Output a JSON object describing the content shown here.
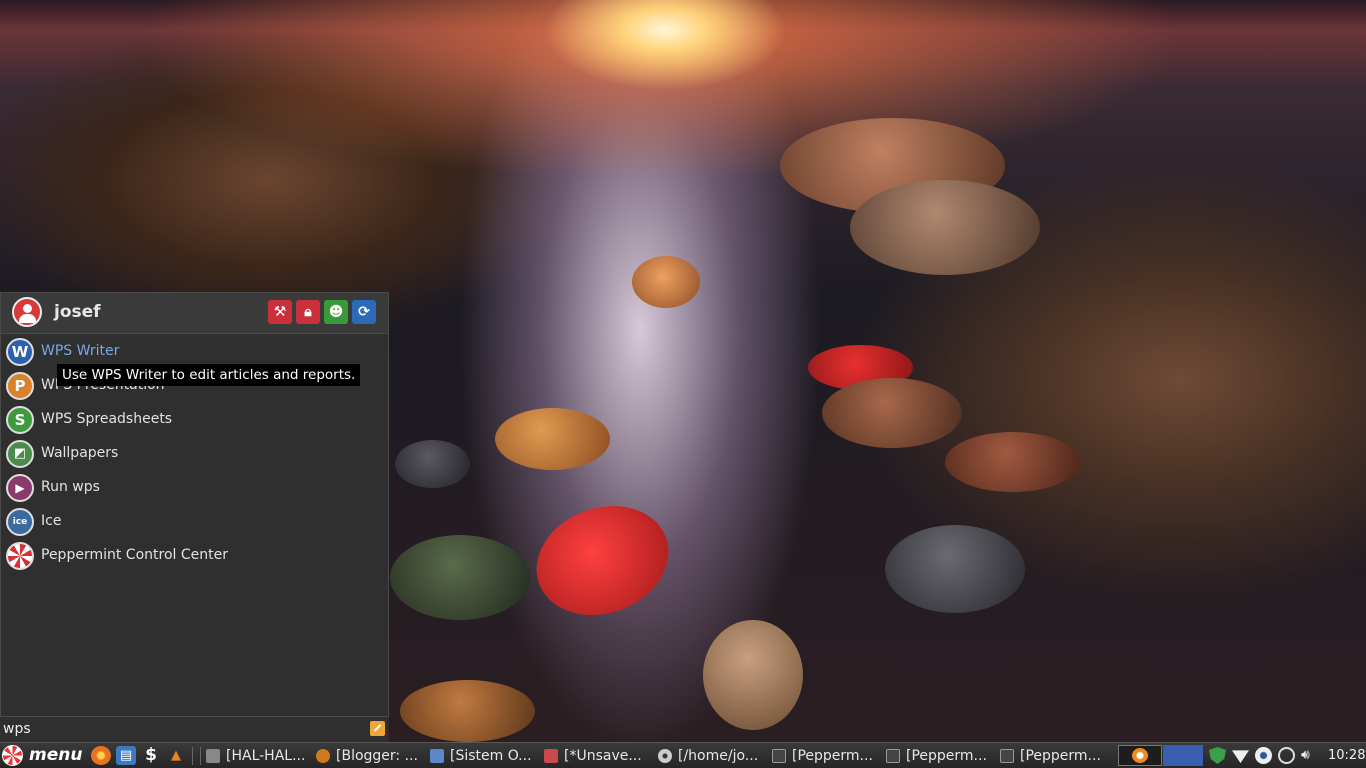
{
  "menu": {
    "username": "josef",
    "header_buttons": [
      {
        "name": "settings",
        "icon": "tools-icon",
        "color": "#c9303a"
      },
      {
        "name": "lock",
        "icon": "lock-icon",
        "color": "#c9303a"
      },
      {
        "name": "users",
        "icon": "users-icon",
        "color": "#3a9a3a"
      },
      {
        "name": "logout",
        "icon": "logout-icon",
        "color": "#2a6ab8"
      }
    ],
    "items": [
      {
        "label": "WPS Writer",
        "letter": "W",
        "color": "#2b5fb0"
      },
      {
        "label": "WPS Presentation",
        "letter": "P",
        "color": "#d9822b"
      },
      {
        "label": "WPS Spreadsheets",
        "letter": "S",
        "color": "#3f9a3f"
      },
      {
        "label": "Wallpapers",
        "letter": "◩",
        "color": "#4a8a4a"
      },
      {
        "label": "Run wps",
        "letter": "▶",
        "color": "#8a3a6a"
      },
      {
        "label": "Ice",
        "letter": "ice",
        "color": "#3a6aa0"
      },
      {
        "label": "Peppermint Control Center",
        "letter": "✺",
        "color": "#d83030"
      }
    ],
    "tooltip": "Use WPS Writer to edit articles and reports.",
    "search_value": "wps"
  },
  "taskbar": {
    "menu_label": "menu",
    "launchers": [
      {
        "name": "firefox",
        "glyph": "◉",
        "color": "#e8731f"
      },
      {
        "name": "file-manager",
        "glyph": "▤",
        "color": "#3a7ac0"
      },
      {
        "name": "terminal",
        "glyph": "$",
        "color": "#333"
      },
      {
        "name": "vlc",
        "glyph": "▲",
        "color": "#e8841a"
      }
    ],
    "tasks": [
      {
        "label": "[HAL-HAL...",
        "color": "#888"
      },
      {
        "label": "[Blogger: ...",
        "color": "#d07a20"
      },
      {
        "label": "[Sistem O...",
        "color": "#5a88c8"
      },
      {
        "label": "[*Unsave...",
        "color": "#c84a4a"
      },
      {
        "label": "[/home/jo...",
        "color": "#aaa"
      },
      {
        "label": "[Pepperm...",
        "color": "#666"
      },
      {
        "label": "[Pepperm...",
        "color": "#666"
      },
      {
        "label": "[Pepperm...",
        "color": "#666"
      }
    ],
    "clock": "10:28"
  }
}
